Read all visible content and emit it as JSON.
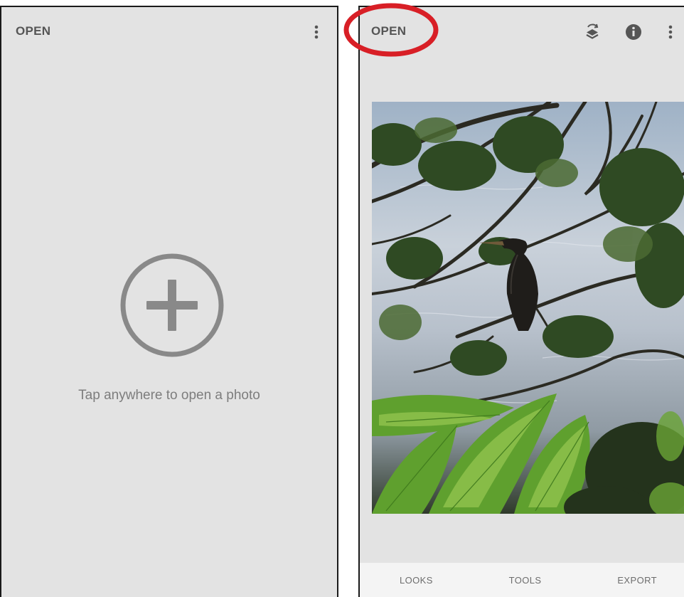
{
  "left_screen": {
    "open_label": "OPEN",
    "menu_icon": "more-vert-icon",
    "add_icon": "add-circle-icon",
    "hint": "Tap anywhere to open a photo"
  },
  "right_screen": {
    "open_label": "OPEN",
    "icons": [
      "layers-stack-icon",
      "info-icon",
      "more-vert-icon"
    ],
    "photo": "cormorant-bird-on-branch-over-water-with-ferns",
    "tabs": [
      "LOOKS",
      "TOOLS",
      "EXPORT"
    ]
  },
  "colors": {
    "screen_bg": "#e3e3e3",
    "text": "#555555",
    "hint_text": "#7d7d7d",
    "highlight": "#d81f26"
  },
  "annotation": {
    "shape": "red-ellipse-around-open"
  }
}
